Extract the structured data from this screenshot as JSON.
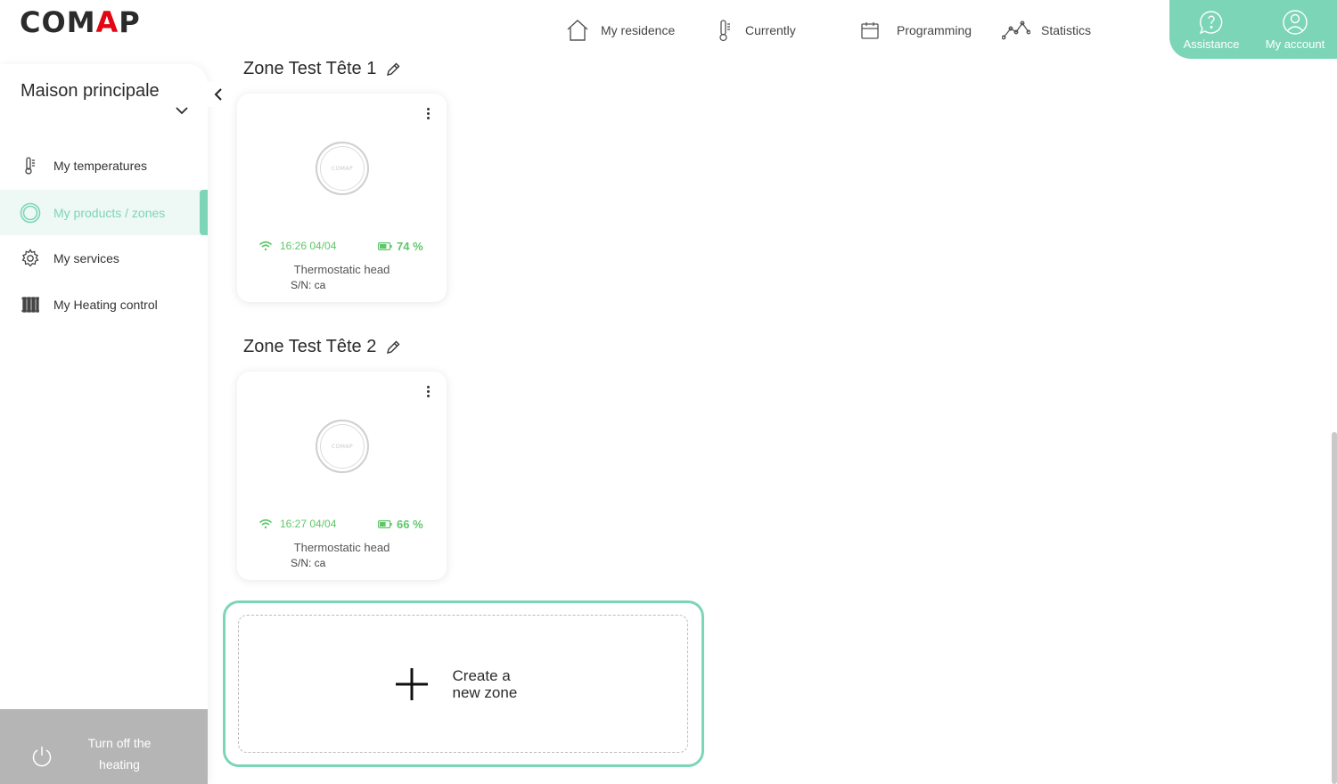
{
  "brand": {
    "logo_pre": "COM",
    "logo_a": "A",
    "logo_post": "P",
    "accent": "#7dd5b8",
    "logo_red": "#e30613"
  },
  "topnav": {
    "items": [
      {
        "label": "My residence",
        "icon": "house-icon"
      },
      {
        "label": "Currently",
        "icon": "thermometer-icon"
      },
      {
        "label": "Programming",
        "icon": "calendar-icon"
      },
      {
        "label": "Statistics",
        "icon": "line-chart-icon"
      }
    ],
    "assistance": "Assistance",
    "account": "My account"
  },
  "sidebar": {
    "residence": "Maison principale",
    "items": [
      {
        "label": "My temperatures",
        "icon": "thermometer-icon"
      },
      {
        "label": "My products / zones",
        "icon": "ring-icon",
        "active": true
      },
      {
        "label": "My services",
        "icon": "gear-icon"
      },
      {
        "label": "My Heating control",
        "icon": "radiator-icon"
      }
    ],
    "turn_off": "Turn off the heating"
  },
  "zones": [
    {
      "title": "Zone Test Tête 1",
      "product": {
        "time": "16:26 04/04",
        "battery": "74 %",
        "battery_level": 0.74,
        "type": "Thermostatic head",
        "sn": "S/N: ca",
        "device_logo": "COMAP"
      }
    },
    {
      "title": "Zone Test Tête 2",
      "product": {
        "time": "16:27 04/04",
        "battery": "66 %",
        "battery_level": 0.66,
        "type": "Thermostatic head",
        "sn": "S/N: ca",
        "device_logo": "COMAP"
      }
    }
  ],
  "create_zone": {
    "line1": "Create a",
    "line2": "new zone"
  }
}
